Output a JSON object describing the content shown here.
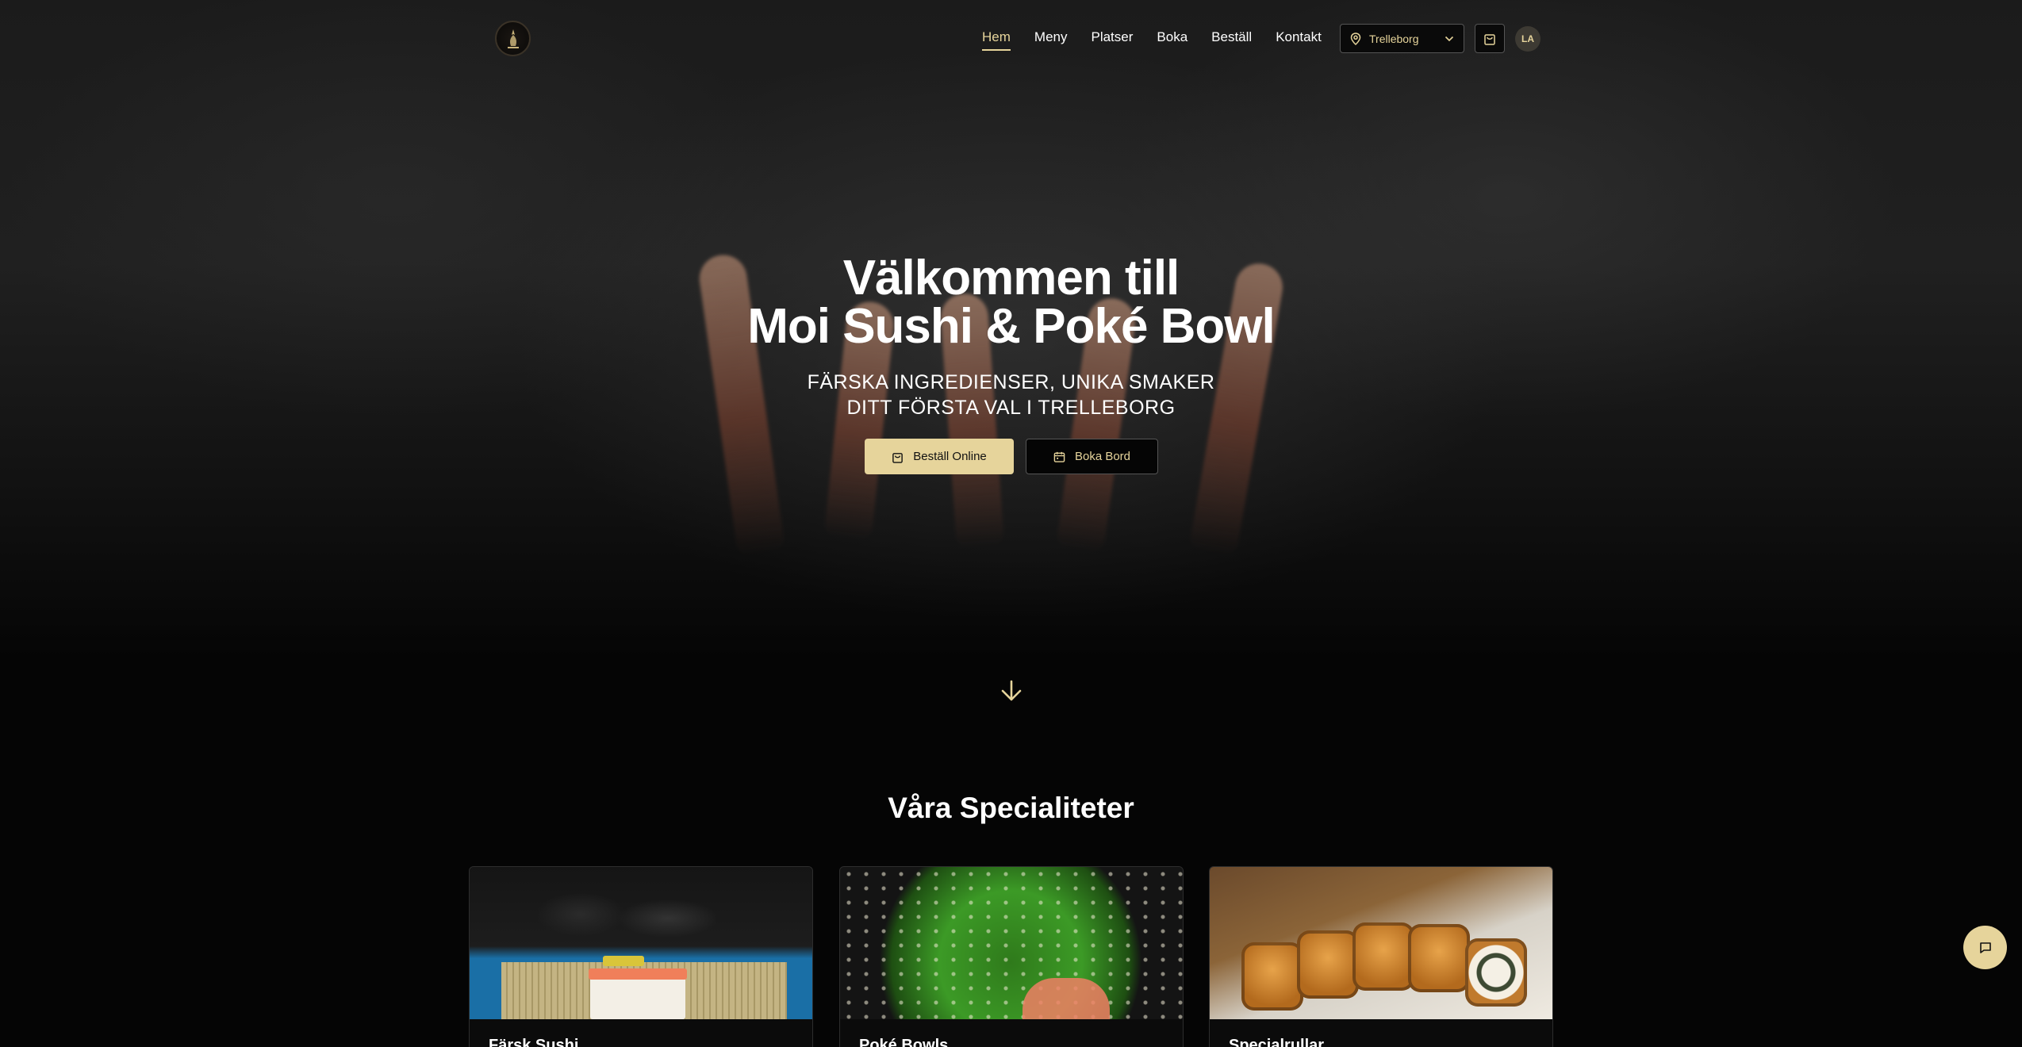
{
  "header": {
    "logo_icon": "restaurant-logo-icon",
    "nav": [
      {
        "label": "Hem",
        "active": true
      },
      {
        "label": "Meny",
        "active": false
      },
      {
        "label": "Platser",
        "active": false
      },
      {
        "label": "Boka",
        "active": false
      },
      {
        "label": "Beställ",
        "active": false
      },
      {
        "label": "Kontakt",
        "active": false
      }
    ],
    "location": "Trelleborg",
    "avatar_initials": "LA"
  },
  "hero": {
    "title_line1": "Välkommen till",
    "title_line2": "Moi Sushi & Poké Bowl",
    "subtitle_line1": "FÄRSKA INGREDIENSER, UNIKA SMAKER",
    "subtitle_line2": "DITT FÖRSTA VAL I TRELLEBORG",
    "order_button": "Beställ Online",
    "book_button": "Boka Bord"
  },
  "specialties": {
    "title": "Våra Specialiteter",
    "cards": [
      {
        "title": "Färsk Sushi"
      },
      {
        "title": "Poké Bowls"
      },
      {
        "title": "Specialrullar"
      }
    ]
  },
  "colors": {
    "accent": "#e6d49b",
    "background": "#050505"
  }
}
